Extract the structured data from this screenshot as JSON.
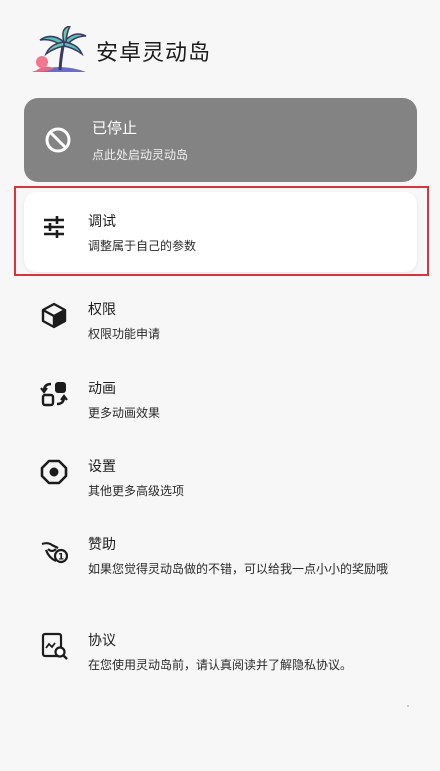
{
  "app": {
    "title": "安卓灵动岛"
  },
  "status": {
    "title": "已停止",
    "subtitle": "点此处启动灵动岛"
  },
  "menu": [
    {
      "title": "调试",
      "subtitle": "调整属于自己的参数",
      "icon": "tune-icon"
    },
    {
      "title": "权限",
      "subtitle": "权限功能申请",
      "icon": "box-icon"
    },
    {
      "title": "动画",
      "subtitle": "更多动画效果",
      "icon": "animation-icon"
    },
    {
      "title": "设置",
      "subtitle": "其他更多高级选项",
      "icon": "settings-icon"
    },
    {
      "title": "赞助",
      "subtitle": "如果您觉得灵动岛做的不错，可以给我一点小小的奖励哦",
      "icon": "donate-icon"
    },
    {
      "title": "协议",
      "subtitle": "在您使用灵动岛前，请认真阅读并了解隐私协议。",
      "icon": "agreement-icon"
    }
  ],
  "colors": {
    "status_card": "#838383",
    "highlight": "#d9343a"
  }
}
